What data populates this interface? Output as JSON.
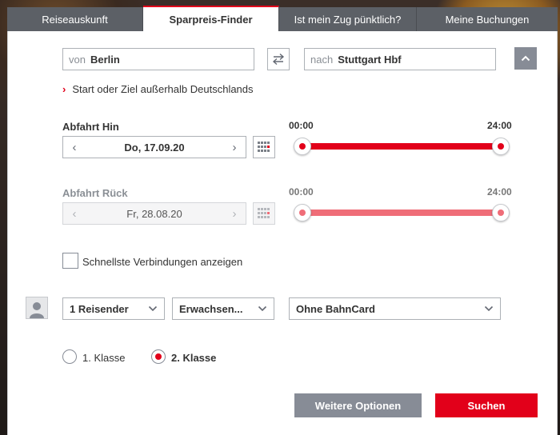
{
  "tabs": [
    {
      "label": "Reiseauskunft",
      "active": false
    },
    {
      "label": "Sparpreis-Finder",
      "active": true
    },
    {
      "label": "Ist mein Zug pünktlich?",
      "active": false
    },
    {
      "label": "Meine Buchungen",
      "active": false
    }
  ],
  "route": {
    "from_prefix": "von",
    "from_value": "Berlin",
    "to_prefix": "nach",
    "to_value": "Stuttgart Hbf",
    "swap_icon": "swap-arrows-icon",
    "collapse_icon": "chevron-up-icon",
    "foreign_link": "Start oder Ziel außerhalb Deutschlands"
  },
  "outbound": {
    "label": "Abfahrt Hin",
    "date": "Do, 17.09.20",
    "time_start": "00:00",
    "time_end": "24:00",
    "range_start_fraction": 0.0,
    "range_end_fraction": 1.0
  },
  "return": {
    "label": "Abfahrt Rück",
    "date": "Fr, 28.08.20",
    "time_start": "00:00",
    "time_end": "24:00",
    "range_start_fraction": 0.0,
    "range_end_fraction": 1.0,
    "disabled": true
  },
  "fastest_connections": {
    "label": "Schnellste Verbindungen anzeigen",
    "checked": false
  },
  "travellers": {
    "count_label": "1 Reisender",
    "age_label": "Erwachsen...",
    "bahncard_label": "Ohne BahnCard"
  },
  "class": {
    "first_label": "1. Klasse",
    "second_label": "2. Klasse",
    "selected": "2"
  },
  "buttons": {
    "more_options": "Weitere Optionen",
    "search": "Suchen"
  },
  "colors": {
    "accent_red": "#e2001a",
    "disabled_red": "#ef6d78",
    "tab_grey": "#5c6066",
    "button_grey": "#878c96"
  }
}
